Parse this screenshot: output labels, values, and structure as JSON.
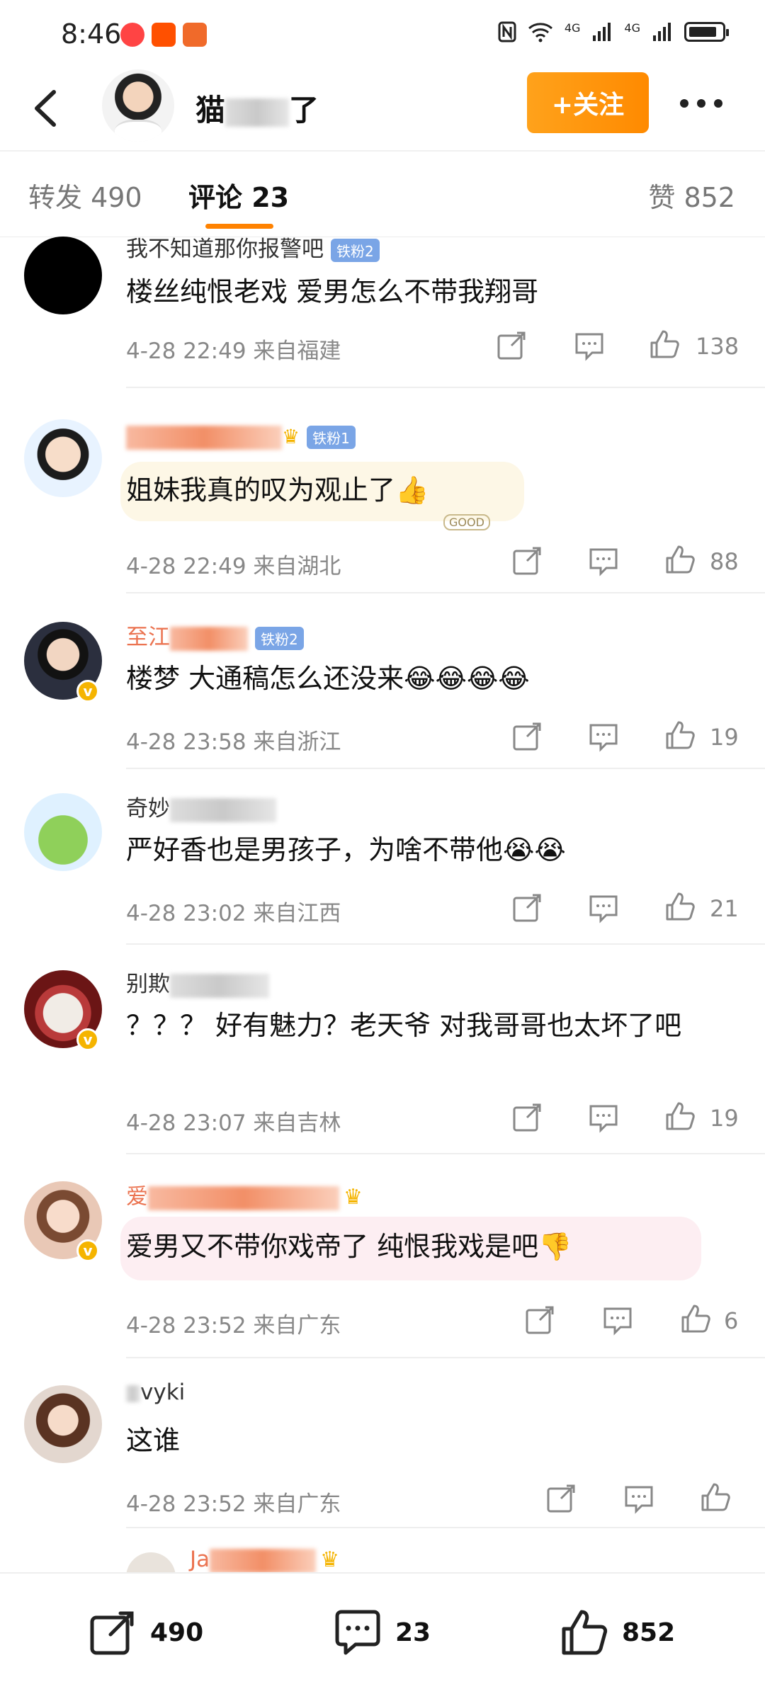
{
  "status_bar": {
    "time": "8:46",
    "signal_labels": [
      "4G",
      "4G"
    ]
  },
  "header": {
    "title_visible": "猫",
    "title_end": "了",
    "follow_label": "+关注"
  },
  "tabs": [
    {
      "label": "转发 490"
    },
    {
      "label": "评论 23"
    },
    {
      "label": "赞 852"
    }
  ],
  "comments": [
    {
      "user_visible": "我不知道那你报警吧",
      "fan_badge": "铁粉2",
      "text": "楼丝纯恨老戏 爱男怎么不带我翔哥",
      "time": "4-28 22:49",
      "location": "来自福建",
      "likes": "138"
    },
    {
      "user_visible": "",
      "fan_badge": "铁粉1",
      "text": "姐妹我真的叹为观止了👍",
      "time": "4-28 22:49",
      "location": "来自湖北",
      "likes": "88",
      "sticker": "GOOD"
    },
    {
      "user_visible": "至江",
      "fan_badge": "铁粉2",
      "text": "楼梦  大通稿怎么还没来😂😂😂😂",
      "time": "4-28 23:58",
      "location": "来自浙江",
      "likes": "19"
    },
    {
      "user_visible": "奇妙",
      "fan_badge": "",
      "text": "严好香也是男孩子，为啥不带他😭😭",
      "time": "4-28 23:02",
      "location": "来自江西",
      "likes": "21"
    },
    {
      "user_visible": "别欺",
      "fan_badge": "",
      "text": "？？？ 好有魅力？老天爷 对我哥哥也太坏了吧",
      "time": "4-28 23:07",
      "location": "来自吉林",
      "likes": "19"
    },
    {
      "user_visible": "爱",
      "fan_badge": "",
      "text": "爱男又不带你戏帝了 纯恨我戏是吧👎",
      "time": "4-28 23:52",
      "location": "来自广东",
      "likes": "6"
    },
    {
      "user_visible": "vyki",
      "fan_badge": "",
      "text": "这谁",
      "time": "4-28 23:52",
      "location": "来自广东",
      "likes": ""
    },
    {
      "user_visible": "Ja",
      "fan_badge": "",
      "text": "",
      "time": "",
      "location": "",
      "likes": ""
    }
  ],
  "bottom_bar": {
    "reposts": "490",
    "comments": "23",
    "likes": "852"
  },
  "colors": {
    "accent": "#ff8200",
    "follow_button": "#ff9a0c",
    "fan_badge": "#7aa5e6",
    "vip_name": "#eb7350",
    "verified": "#f5b400"
  }
}
